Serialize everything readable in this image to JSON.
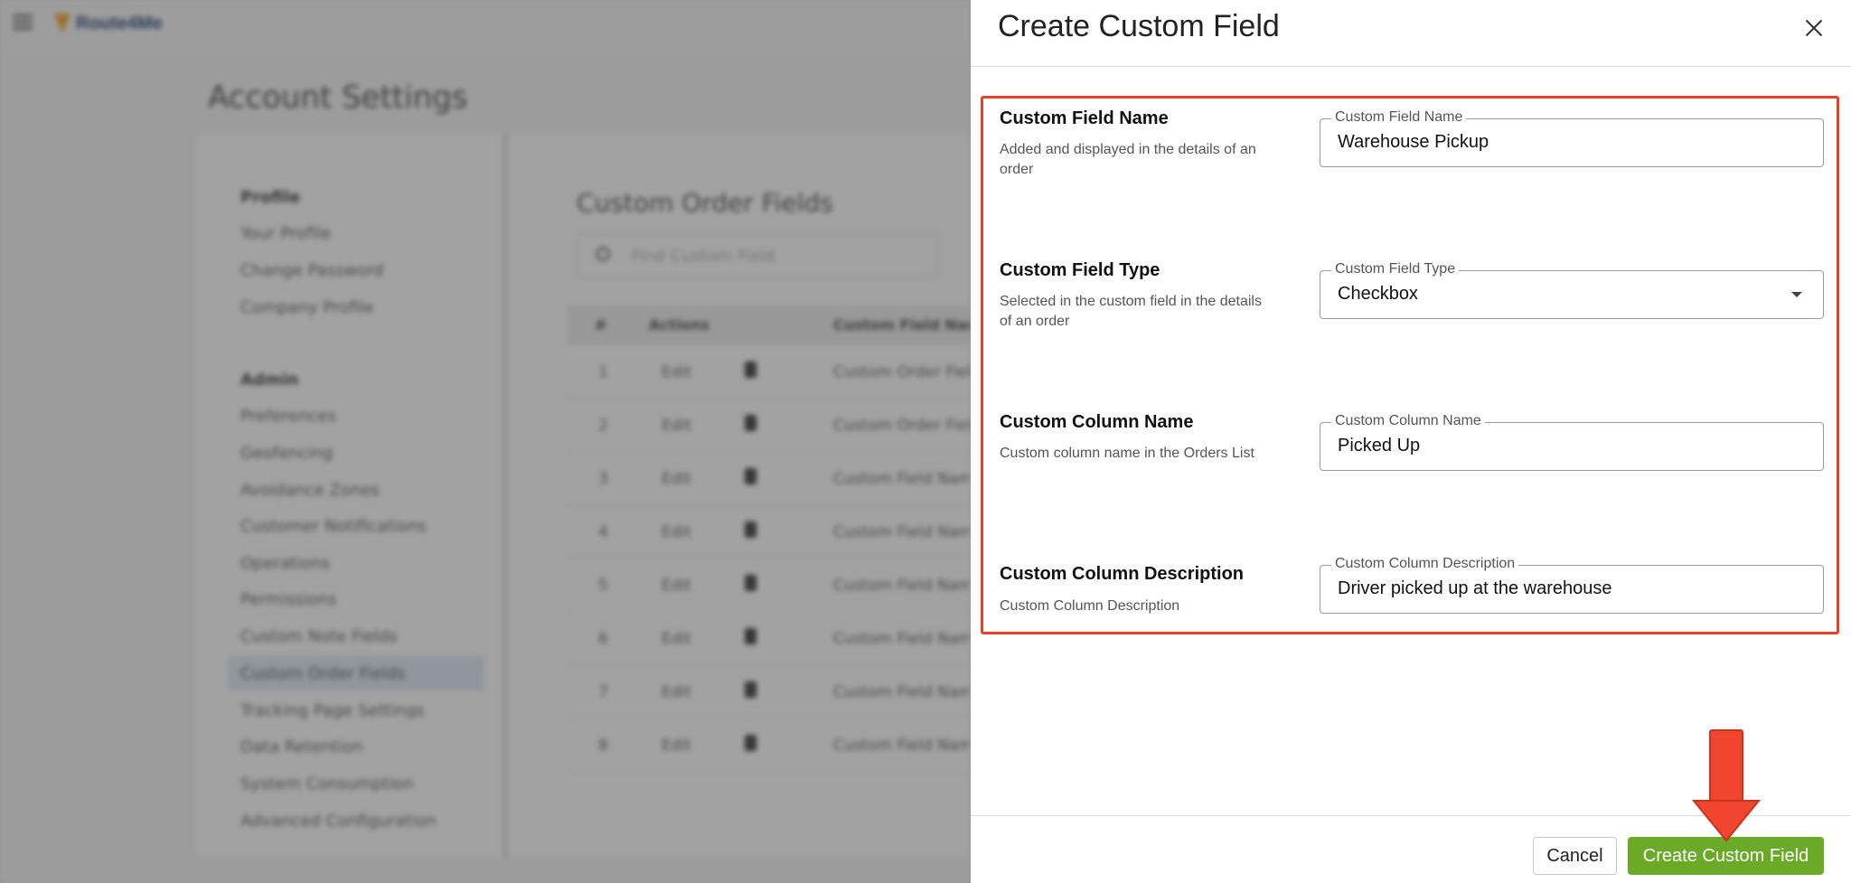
{
  "app": {
    "logo_text": "Route4Me",
    "page_title": "Account Settings"
  },
  "sidebar": {
    "sections": [
      {
        "heading": "Profile",
        "items": [
          "Your Profile",
          "Change Password",
          "Company Profile"
        ]
      },
      {
        "heading": "Admin",
        "items": [
          "Preferences",
          "Geofencing",
          "Avoidance Zones",
          "Customer Notifications",
          "Operations",
          "Permissions",
          "Custom Note Fields",
          "Custom Order Fields",
          "Tracking Page Settings",
          "Data Retention",
          "System Consumption",
          "Advanced Configuration"
        ]
      }
    ],
    "active_item": "Custom Order Fields"
  },
  "content": {
    "title": "Custom Order Fields",
    "search_placeholder": "Find Custom Field",
    "columns": [
      "#",
      "Actions",
      "Custom Field Name"
    ],
    "rows": [
      {
        "num": "1",
        "edit": "Edit",
        "name": "Custom Order Field"
      },
      {
        "num": "2",
        "edit": "Edit",
        "name": "Custom Order Field"
      },
      {
        "num": "3",
        "edit": "Edit",
        "name": "Custom Field Name"
      },
      {
        "num": "4",
        "edit": "Edit",
        "name": "Custom Field Name"
      },
      {
        "num": "5",
        "edit": "Edit",
        "name": "Custom Field Name"
      },
      {
        "num": "6",
        "edit": "Edit",
        "name": "Custom Field Name"
      },
      {
        "num": "7",
        "edit": "Edit",
        "name": "Custom Field Name"
      },
      {
        "num": "8",
        "edit": "Edit",
        "name": "Custom Field Name"
      }
    ]
  },
  "drawer": {
    "title": "Create Custom Field",
    "fields": [
      {
        "label": "Custom Field Name",
        "help": "Added and displayed in the details of an order",
        "input_label": "Custom Field Name",
        "value": "Warehouse Pickup",
        "type": "text"
      },
      {
        "label": "Custom Field Type",
        "help": "Selected in the custom field in the details of an order",
        "input_label": "Custom Field Type",
        "value": "Checkbox",
        "type": "select"
      },
      {
        "label": "Custom Column Name",
        "help": "Custom column name in the Orders List",
        "input_label": "Custom Column Name",
        "value": "Picked Up",
        "type": "text"
      },
      {
        "label": "Custom Column Description",
        "help": "Custom Column Description",
        "input_label": "Custom Column Description",
        "value": "Driver picked up at the warehouse",
        "type": "text"
      }
    ],
    "cancel_label": "Cancel",
    "create_label": "Create Custom Field"
  },
  "colors": {
    "highlight_border": "#e8402a",
    "create_button": "#6aaa27",
    "annotation_arrow": "#f0452e"
  },
  "icons": {
    "menu": "hamburger-icon",
    "close": "close-icon",
    "dropdown": "chevron-down-icon",
    "search": "search-icon",
    "delete": "trash-icon",
    "annotation": "down-arrow-icon"
  }
}
